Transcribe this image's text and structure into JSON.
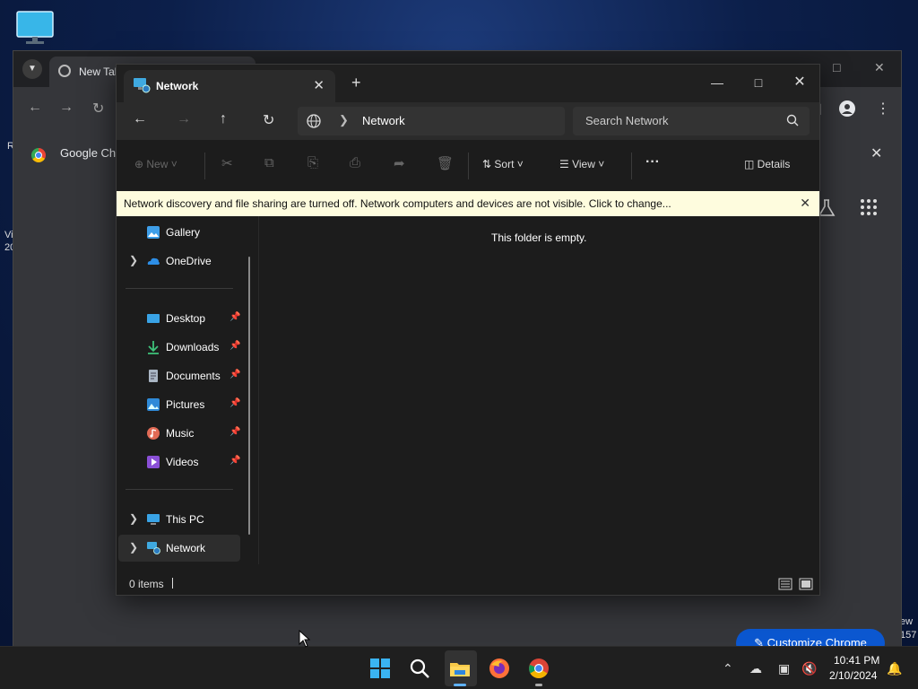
{
  "desktop": {
    "left_labels": [
      "R",
      "Vi",
      "20"
    ],
    "right_labels": [
      "ew",
      "157"
    ]
  },
  "chrome": {
    "tab_title": "New Tab",
    "bookmark": "Google Ch",
    "customize_label": "Customize Chrome"
  },
  "explorer": {
    "tab_title": "Network",
    "new_tab": "+",
    "address": {
      "location": "Network"
    },
    "search": {
      "placeholder": "Search Network"
    },
    "commands": {
      "new": "New",
      "sort": "Sort",
      "view": "View",
      "more": "···",
      "details": "Details"
    },
    "banner": "Network discovery and file sharing are turned off. Network computers and devices are not visible. Click to change...",
    "sidebar": {
      "items": [
        {
          "label": "Gallery",
          "icon": "gallery-icon"
        },
        {
          "label": "OneDrive",
          "icon": "onedrive-icon"
        },
        {
          "label": "Desktop",
          "icon": "desktop-folder-icon"
        },
        {
          "label": "Downloads",
          "icon": "downloads-icon"
        },
        {
          "label": "Documents",
          "icon": "documents-icon"
        },
        {
          "label": "Pictures",
          "icon": "pictures-icon"
        },
        {
          "label": "Music",
          "icon": "music-icon"
        },
        {
          "label": "Videos",
          "icon": "videos-icon"
        },
        {
          "label": "This PC",
          "icon": "this-pc-icon"
        },
        {
          "label": "Network",
          "icon": "network-icon"
        }
      ]
    },
    "content": {
      "empty_text": "This folder is empty."
    },
    "status": {
      "item_count": "0 items"
    }
  },
  "taskbar": {
    "clock_time": "10:41 PM",
    "clock_date": "2/10/2024"
  },
  "colors": {
    "banner_bg": "#fefcde",
    "explorer_bg": "#1c1c1c",
    "accent": "#0b57d0"
  }
}
